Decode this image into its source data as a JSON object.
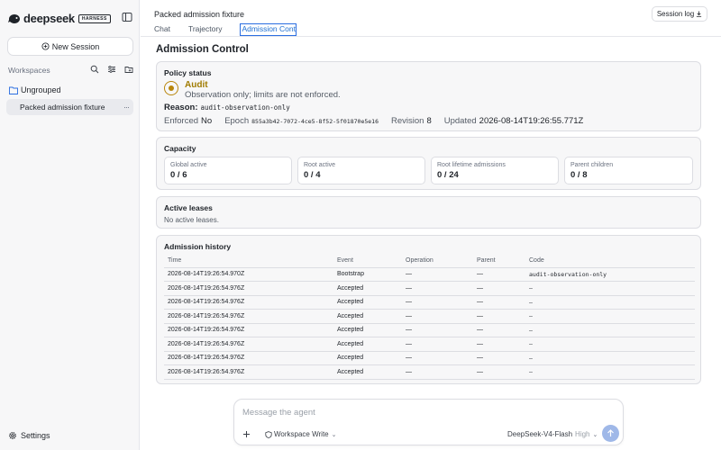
{
  "sidebar": {
    "brand": "deepseek",
    "badge": "HARNESS",
    "new_session_label": "New Session",
    "workspaces_label": "Workspaces",
    "group_label": "Ungrouped",
    "session_item": "Packed admission fixture",
    "settings_label": "Settings"
  },
  "header": {
    "title": "Packed admission fixture",
    "session_log_label": "Session log",
    "tabs": [
      {
        "label": "Chat"
      },
      {
        "label": "Trajectory"
      },
      {
        "label": "Admission Control"
      }
    ],
    "active_tab": "Admission Control"
  },
  "admission": {
    "heading": "Admission Control",
    "policy": {
      "title": "Policy status",
      "mode": "Audit",
      "description": "Observation only; limits are not enforced.",
      "reason_label": "Reason:",
      "reason": "audit-observation-only",
      "enforced_label": "Enforced",
      "enforced": "No",
      "epoch_label": "Epoch",
      "epoch": "855a3b42-7072-4ce5-8f52-5f01870e5e16",
      "revision_label": "Revision",
      "revision": "8",
      "updated_label": "Updated",
      "updated": "2026-08-14T19:26:55.771Z"
    },
    "capacity": {
      "title": "Capacity",
      "items": [
        {
          "label": "Global active",
          "value": "0 / 6"
        },
        {
          "label": "Root active",
          "value": "0 / 4"
        },
        {
          "label": "Root lifetime admissions",
          "value": "0 / 24"
        },
        {
          "label": "Parent children",
          "value": "0 / 8"
        }
      ]
    },
    "leases": {
      "title": "Active leases",
      "empty": "No active leases."
    },
    "history": {
      "title": "Admission history",
      "columns": [
        "Time",
        "Event",
        "Operation",
        "Parent",
        "Code"
      ],
      "rows": [
        [
          "2026-08-14T19:26:54.970Z",
          "Bootstrap",
          "—",
          "—",
          "audit-observation-only"
        ],
        [
          "2026-08-14T19:26:54.976Z",
          "Accepted",
          "—",
          "—",
          "—"
        ],
        [
          "2026-08-14T19:26:54.976Z",
          "Accepted",
          "—",
          "—",
          "—"
        ],
        [
          "2026-08-14T19:26:54.976Z",
          "Accepted",
          "—",
          "—",
          "—"
        ],
        [
          "2026-08-14T19:26:54.976Z",
          "Accepted",
          "—",
          "—",
          "—"
        ],
        [
          "2026-08-14T19:26:54.976Z",
          "Accepted",
          "—",
          "—",
          "—"
        ],
        [
          "2026-08-14T19:26:54.976Z",
          "Accepted",
          "—",
          "—",
          "—"
        ],
        [
          "2026-08-14T19:26:54.976Z",
          "Accepted",
          "—",
          "—",
          "—"
        ]
      ]
    }
  },
  "composer": {
    "placeholder": "Message the agent",
    "workspace_mode": "Workspace Write",
    "model": "DeepSeek-V4-Flash",
    "effort": "High"
  },
  "colors": {
    "accent": "#2a6de0",
    "audit": "#a07b00",
    "send_disabled": "#9fb8e8"
  }
}
